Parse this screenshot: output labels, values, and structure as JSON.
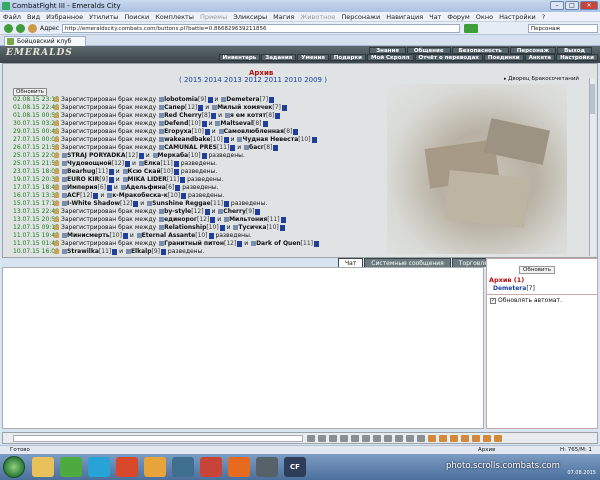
{
  "window": {
    "title": "CombatFight III - Emeralds City"
  },
  "menu": [
    "Файл",
    "Вид",
    "Избранное",
    "Утилиты",
    "Поиски",
    "Комплекты",
    "Приемы",
    "Эликсиры",
    "Магия",
    "Животное",
    "Персонажи",
    "Навигация",
    "Чат",
    "Форум",
    "Окно",
    "Настройки",
    "?"
  ],
  "address": {
    "label": "Адрес",
    "url": "http://emeraldscity.combats.com/buttons.pl?battle=0.866829639211856",
    "search": "Персонаж"
  },
  "tab": {
    "label": "Бойцовский клуб"
  },
  "game": {
    "logo": "EMERALDS",
    "nav_top": [
      "Знания",
      "Общение",
      "Безопасность",
      "Персонаж",
      "Выход"
    ],
    "nav_bottom": [
      "Инвентарь",
      "Задания",
      "Умения",
      "Подарки",
      "Мой Скролл",
      "Отчёт о переводах",
      "Поединки",
      "Анкета",
      "Настройки"
    ]
  },
  "archive": {
    "title": "Архив",
    "years": "( 2015 2014 2013 2012 2011 2010 2009 )",
    "palace": "Дворец Бракосочетаний",
    "refresh": "Обновить",
    "entries": [
      {
        "time": "02.08.15 23:15",
        "text": "Зарегистрирован брак между",
        "a": "lobotomia",
        "al": "[9]",
        "b": "Demetera",
        "bl": "[7]",
        "tail": ""
      },
      {
        "time": "01.08.15 22:49",
        "text": "Зарегистрирован брак между",
        "a": "Сапер",
        "al": "[12]",
        "b": "Милый хомячек",
        "bl": "[7]",
        "tail": ""
      },
      {
        "time": "01.08.15 00:56",
        "text": "Зарегистрирован брак между",
        "a": "Red Cherry",
        "al": "[8]",
        "b": "я ем котят",
        "bl": "[8]",
        "tail": ""
      },
      {
        "time": "30.07.15 03:26",
        "text": "Зарегистрирован брак между",
        "a": "Defend",
        "al": "[10]",
        "b": "Maltseval",
        "bl": "[8]",
        "tail": ""
      },
      {
        "time": "29.07.15 00:48",
        "text": "Зарегистрирован брак между",
        "a": "Егоруха",
        "al": "[10]",
        "b": "Самовлюбленная",
        "bl": "[8]",
        "tail": ""
      },
      {
        "time": "27.07.15 00:08",
        "text": "Зарегистрирован брак между",
        "a": "wakeandbake",
        "al": "[10]",
        "b": "Чудная Невеста",
        "bl": "[10]",
        "tail": ""
      },
      {
        "time": "26.07.15 21:53",
        "text": "Зарегистрирован брак между",
        "a": "CAMUNAL PRES",
        "al": "[11]",
        "b": "басг",
        "bl": "[8]",
        "tail": ""
      },
      {
        "time": "25.07.15 22:01",
        "text": "",
        "a": "STRAJ PORYADKA",
        "al": "[12]",
        "b": "Меркаба",
        "bl": "[10]",
        "tail": "разведены."
      },
      {
        "time": "25.07.15 21:55",
        "text": "",
        "a": "Чудовощной",
        "al": "[12]",
        "b": "Елка",
        "bl": "[11]",
        "tail": "разведены."
      },
      {
        "time": "23.07.15 18:07",
        "text": "",
        "a": "Bearhug",
        "al": "[11]",
        "b": "Ксю Скай",
        "bl": "[10]",
        "tail": "разведены."
      },
      {
        "time": "19.07.15 20:37",
        "text": "",
        "a": "EURO KIR",
        "al": "[9]",
        "b": "MIKA LIDER",
        "bl": "[11]",
        "tail": "разведены."
      },
      {
        "time": "17.07.15 18:42",
        "text": "",
        "a": "Империя",
        "al": "[6]",
        "b": "Адельфина",
        "bl": "[6]",
        "tail": "разведены."
      },
      {
        "time": "16.07.15 13:35",
        "text": "",
        "a": "ACF",
        "al": "[12]",
        "b": "к-Мракобеска-к",
        "bl": "[10]",
        "tail": "разведены."
      },
      {
        "time": "15.07.15 17:11",
        "text": "",
        "a": "I-White Shadow",
        "al": "[12]",
        "b": "Sunshine Reggae",
        "bl": "[11]",
        "tail": "разведены."
      },
      {
        "time": "13.07.15 22:40",
        "text": "Зарегистрирован брак между",
        "a": "by-style",
        "al": "[12]",
        "b": "Cherry",
        "bl": "[9]",
        "tail": ""
      },
      {
        "time": "13.07.15 20:58",
        "text": "Зарегистрирован брак между",
        "a": "единорог",
        "al": "[12]",
        "b": "Мильтония",
        "bl": "[11]",
        "tail": ""
      },
      {
        "time": "12.07.15 09:15",
        "text": "Зарегистрирован брак между",
        "a": "Relationship",
        "al": "[10]",
        "b": "Тусичка",
        "bl": "[10]",
        "tail": ""
      },
      {
        "time": "11.07.15 19:48",
        "text": "",
        "a": "Минисмерть",
        "al": "[10]",
        "b": "Eternal Assante",
        "bl": "[10]",
        "tail": "разведены."
      },
      {
        "time": "11.07.15 01:43",
        "text": "Зарегистрирован брак между",
        "a": "Гранитный питон",
        "al": "[12]",
        "b": "Dark of Quen",
        "bl": "[11]",
        "tail": ""
      },
      {
        "time": "10.07.15 16:00",
        "text": "",
        "a": "Strawilka",
        "al": "[11]",
        "b": "Elkalp",
        "bl": "[9]",
        "tail": "разведены."
      }
    ]
  },
  "subtabs": [
    "Чат",
    "Системные сообщения",
    "Торговля"
  ],
  "side": {
    "refresh": "Обновить",
    "title": "Архив (1)",
    "user": "Demetera",
    "user_level": "[7]",
    "auto": "Обновлять автомат."
  },
  "status": {
    "left": "Готово",
    "middle": "Архив",
    "right": "Н: 765/М: 1"
  },
  "watermark": "photo.scrolls.combats.com",
  "clock": "07.08.2015"
}
